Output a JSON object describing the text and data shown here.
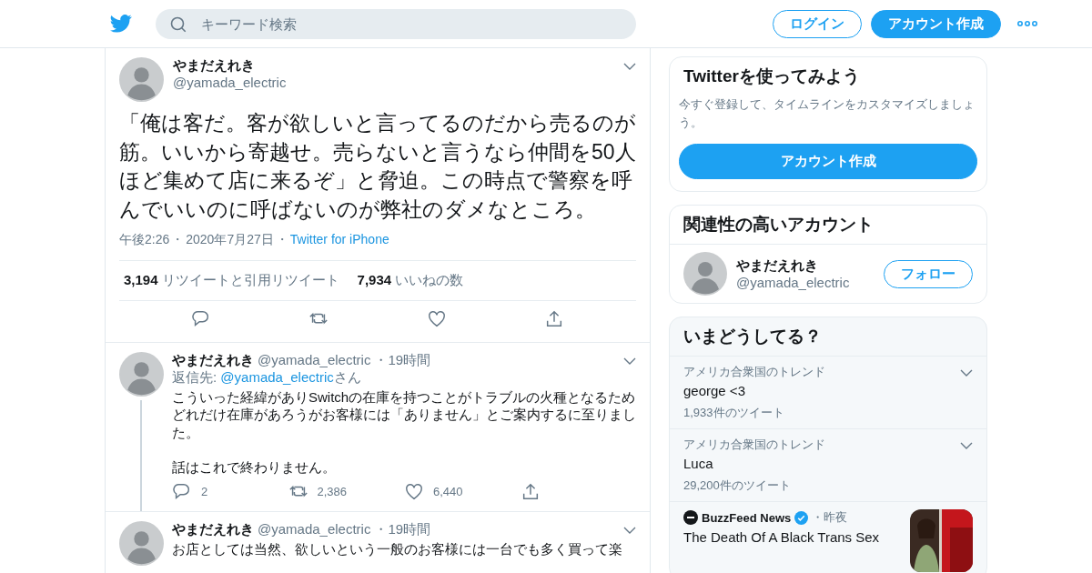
{
  "header": {
    "search": {
      "placeholder": "キーワード検索"
    },
    "buttons": [
      {
        "label": "ログイン",
        "kind": "outline"
      },
      {
        "label": "アカウント作成",
        "kind": "primary"
      }
    ]
  },
  "main_tweet": {
    "name": "やまだえれき",
    "handle": "@yamada_electric",
    "text": "「俺は客だ。客が欲しいと言ってるのだから売るのが筋。いいから寄越せ。売らないと言うなら仲間を50人ほど集めて店に来るぞ」と脅迫。この時点で警察を呼んでいいのに呼ばないのが弊社のダメなところ。",
    "meta": [
      {
        "kind": "time",
        "text": "午後2:26"
      },
      {
        "kind": "separator",
        "text": "・"
      },
      {
        "kind": "date",
        "text": "2020年7月27日"
      },
      {
        "kind": "separator",
        "text": "・"
      },
      {
        "kind": "source",
        "text": "Twitter for iPhone"
      }
    ],
    "stats": [
      {
        "count": "3,194",
        "label": "リツイートと引用リツイート"
      },
      {
        "count": "7,934",
        "label": "いいねの数"
      }
    ],
    "actions": [
      {
        "kind": "reply"
      },
      {
        "kind": "retweet"
      },
      {
        "kind": "like"
      },
      {
        "kind": "share"
      }
    ]
  },
  "replies": [
    {
      "name": "やまだえれき",
      "handle": "@yamada_electric",
      "age": "・19時間",
      "reply_to": {
        "prefix": "返信先: ",
        "handle": "@yamada_electric",
        "suffix": "さん"
      },
      "paragraphs": [
        "こういった経緯がありSwitchの在庫を持つことがトラブルの火種となるためどれだけ在庫があろうがお客様には「ありません」とご案内するに至りました。",
        "話はこれで終わりません。"
      ],
      "actions": [
        {
          "kind": "reply",
          "count": "2"
        },
        {
          "kind": "retweet",
          "count": "2,386"
        },
        {
          "kind": "like",
          "count": "6,440"
        },
        {
          "kind": "share"
        }
      ]
    },
    {
      "name": "やまだえれき",
      "handle": "@yamada_electric",
      "age": "・19時間",
      "paragraphs": [
        "お店としては当然、欲しいという一般のお客様には一台でも多く買って楽"
      ]
    }
  ],
  "sidebar": {
    "signup": {
      "title": "Twitterを使ってみよう",
      "text": "今すぐ登録して、タイムラインをカスタマイズしましょう。",
      "button": "アカウント作成"
    },
    "related": {
      "title": "関連性の高いアカウント",
      "accounts": [
        {
          "name": "やまだえれき",
          "handle": "@yamada_electric",
          "button": "フォロー"
        }
      ]
    },
    "trends": {
      "title": "いまどうしてる？",
      "items": [
        {
          "kind": "trend",
          "context": "アメリカ合衆国のトレンド",
          "topic": "george <3",
          "count": "1,933件のツイート"
        },
        {
          "kind": "trend",
          "context": "アメリカ合衆国のトレンド",
          "topic": "Luca",
          "count": "29,200件のツイート"
        },
        {
          "kind": "news",
          "source": "BuzzFeed News",
          "verified": true,
          "age": "・昨夜",
          "headline": "The Death Of A Black Trans Sex"
        }
      ]
    }
  }
}
